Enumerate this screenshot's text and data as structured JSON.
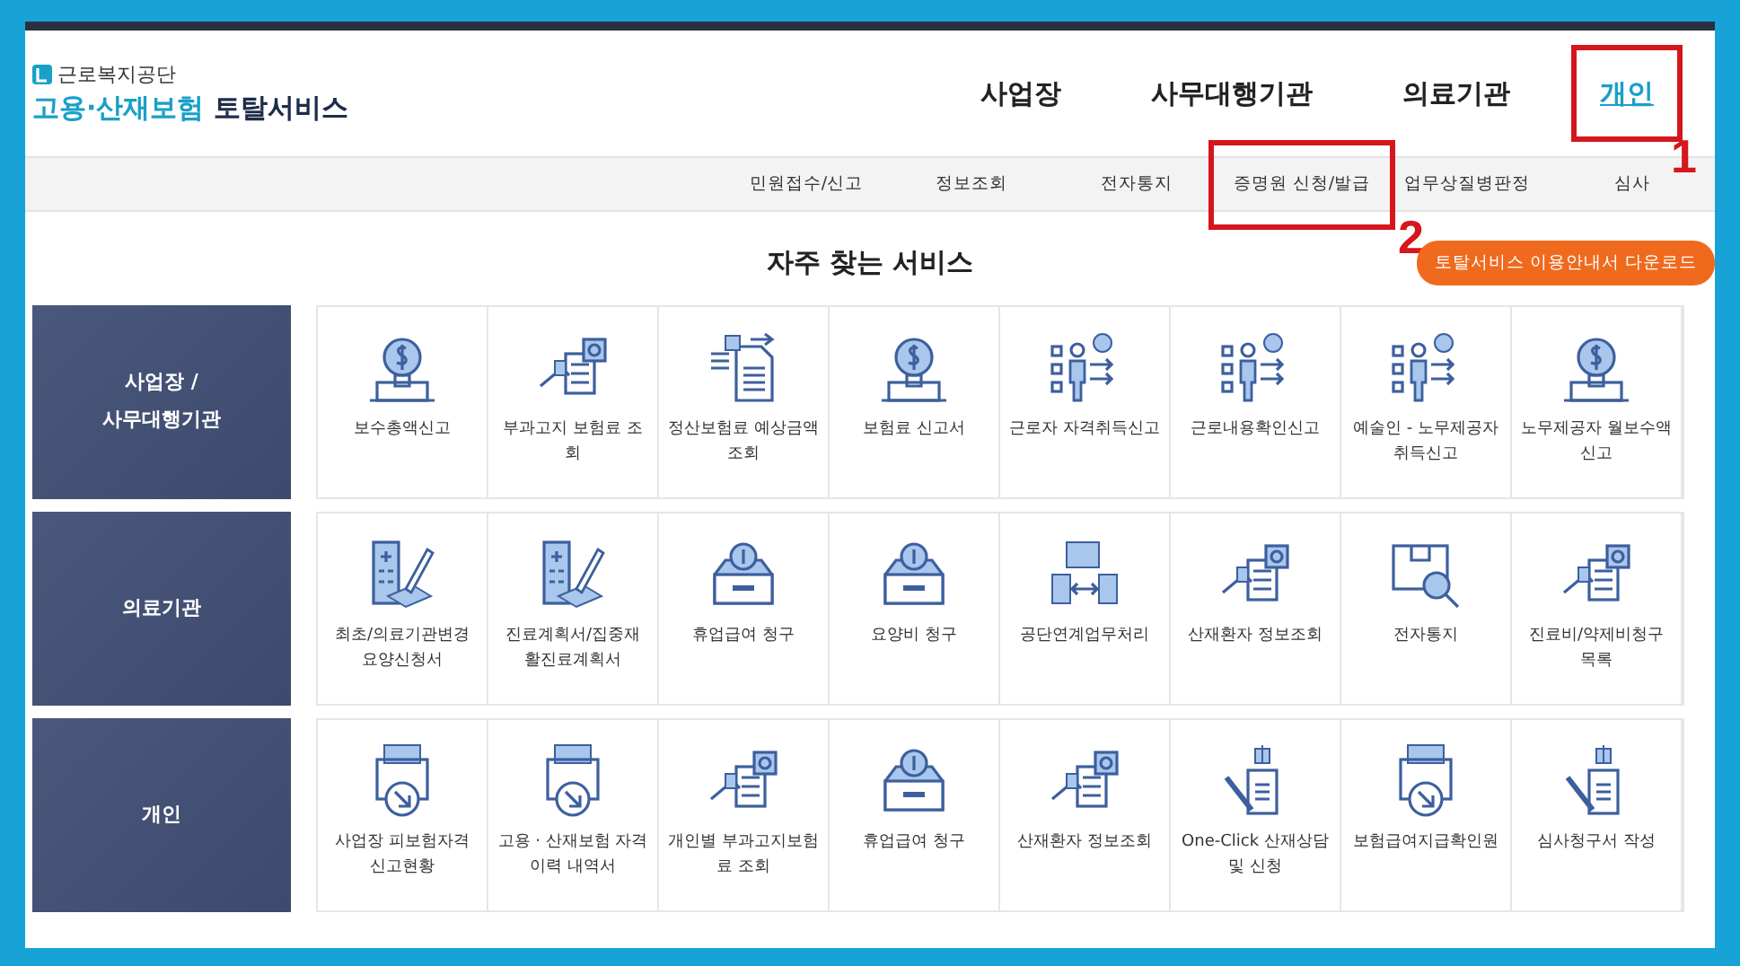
{
  "logo": {
    "org": "근로복지공단",
    "service_blue": "고용·산재보험",
    "service_dark": "토탈서비스"
  },
  "main_nav": [
    {
      "label": "사업장",
      "selected": false
    },
    {
      "label": "사무대행기관",
      "selected": false
    },
    {
      "label": "의료기관",
      "selected": false
    },
    {
      "label": "개인",
      "selected": true,
      "annotation": "1"
    }
  ],
  "sub_nav": [
    {
      "label": "민원접수/신고"
    },
    {
      "label": "정보조회"
    },
    {
      "label": "전자통지"
    },
    {
      "label": "증명원 신청/발급",
      "annotation": "2"
    },
    {
      "label": "업무상질병판정"
    },
    {
      "label": "심사"
    }
  ],
  "section_title": "자주 찾는 서비스",
  "guide_button": "토탈서비스 이용안내서 다운로드",
  "sections": [
    {
      "title": "사업장 /\n사무대행기관",
      "items": [
        {
          "kind": "bulb",
          "label": "보수총액신고"
        },
        {
          "kind": "search",
          "label": "부과고지 보험료 조회"
        },
        {
          "kind": "arrows",
          "label": "정산보험료 예상금액 조회"
        },
        {
          "kind": "bulb",
          "label": "보험료 신고서"
        },
        {
          "kind": "person",
          "label": "근로자 자격취득신고"
        },
        {
          "kind": "person",
          "label": "근로내용확인신고"
        },
        {
          "kind": "person",
          "label": "예술인 - 노무제공자 취득신고"
        },
        {
          "kind": "bulb",
          "label": "노무제공자 월보수액 신고"
        }
      ]
    },
    {
      "title": "의료기관",
      "items": [
        {
          "kind": "hospital",
          "label": "최초/의료기관변경 요양신청서"
        },
        {
          "kind": "hospital",
          "label": "진료계획서/집중재활진료계획서"
        },
        {
          "kind": "coinbox",
          "label": "휴업급여 청구"
        },
        {
          "kind": "coinbox",
          "label": "요양비 청구"
        },
        {
          "kind": "exchange",
          "label": "공단연계업무처리"
        },
        {
          "kind": "search",
          "label": "산재환자 정보조회"
        },
        {
          "kind": "package",
          "label": "전자통지"
        },
        {
          "kind": "search",
          "label": "진료비/약제비청구 목록"
        }
      ]
    },
    {
      "title": "개인",
      "items": [
        {
          "kind": "printer",
          "label": "사업장 피보험자격 신고현황"
        },
        {
          "kind": "printer",
          "label": "고용 · 산재보험 자격 이력 내역서"
        },
        {
          "kind": "search",
          "label": "개인별 부과고지보험료 조회"
        },
        {
          "kind": "coinbox",
          "label": "휴업급여 청구"
        },
        {
          "kind": "search",
          "label": "산재환자 정보조회"
        },
        {
          "kind": "pin",
          "label": "One-Click 산재상담 및 신청"
        },
        {
          "kind": "printer",
          "label": "보험급여지급확인원"
        },
        {
          "kind": "pin",
          "label": "심사청구서 작성"
        }
      ]
    }
  ]
}
